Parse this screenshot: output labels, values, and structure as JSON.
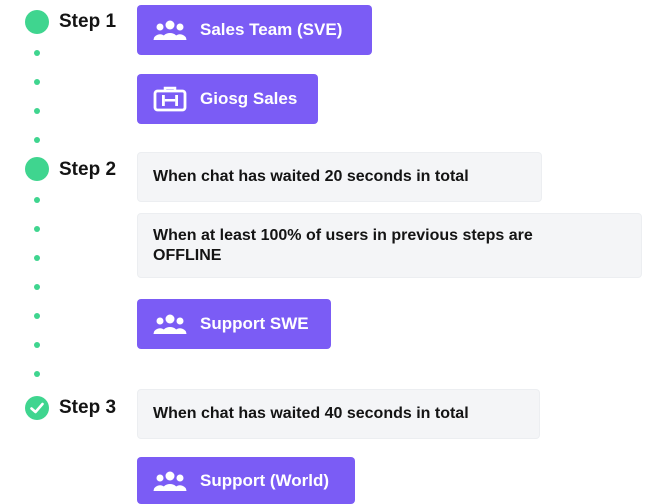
{
  "steps": [
    {
      "label": "Step 1"
    },
    {
      "label": "Step 2"
    },
    {
      "label": "Step 3"
    }
  ],
  "groups": {
    "sales_team": "Sales Team (SVE)",
    "giosg_sales": "Giosg Sales",
    "support_swe": "Support SWE",
    "support_world": "Support (World)"
  },
  "conditions": {
    "wait_20": {
      "prefix": "When chat has waited",
      "value": "20",
      "suffix": "seconds in total"
    },
    "offline_100": {
      "prefix": "When at least",
      "value": "100%",
      "suffix": "of users in previous steps are OFFLINE"
    },
    "wait_40": {
      "prefix": "When chat has waited",
      "value": "40",
      "suffix": "seconds in total"
    }
  },
  "colors": {
    "accent_purple": "#7b5cf5",
    "step_green": "#3fd58f",
    "condition_bg": "#f4f5f7"
  },
  "icons": {
    "group": "users-group-icon",
    "office": "briefcase-icon",
    "done": "check-icon"
  }
}
